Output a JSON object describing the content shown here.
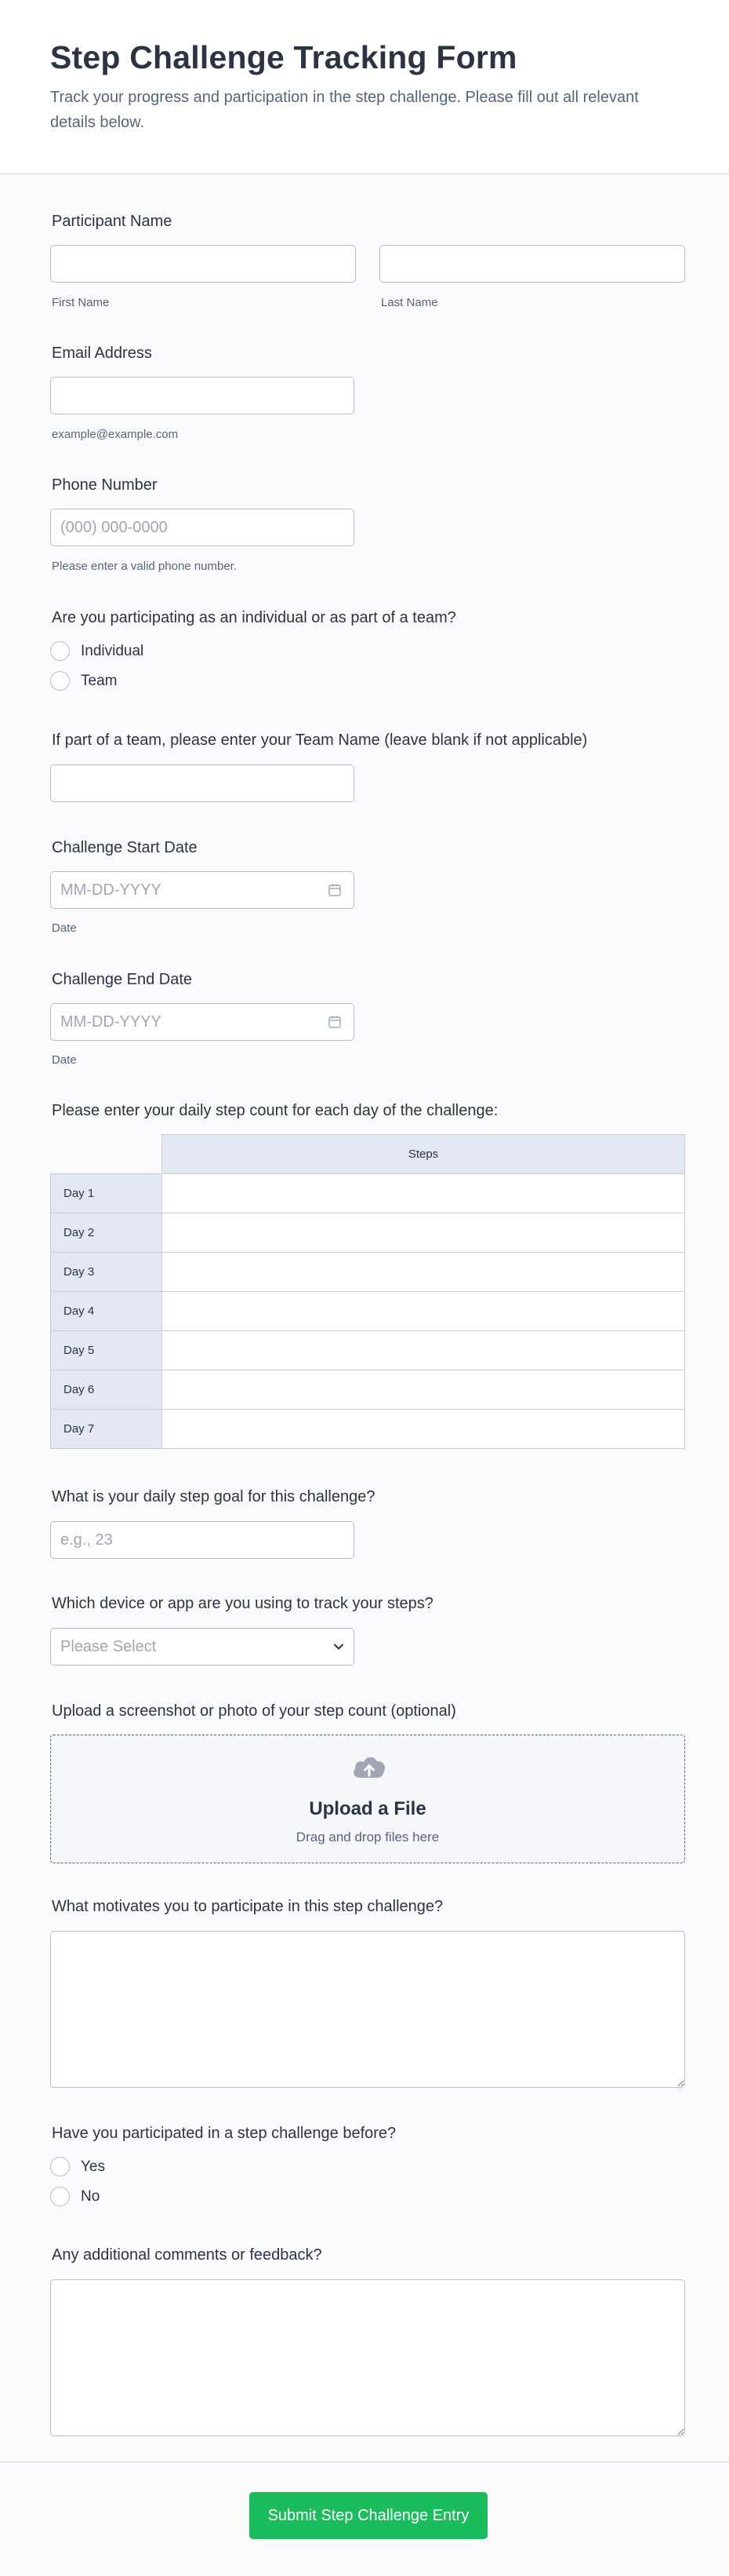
{
  "header": {
    "title": "Step Challenge Tracking Form",
    "subtitle": "Track your progress and participation in the step challenge. Please fill out all relevant details below."
  },
  "participant_name": {
    "label": "Participant Name",
    "first_sublabel": "First Name",
    "last_sublabel": "Last Name"
  },
  "email": {
    "label": "Email Address",
    "sublabel": "example@example.com"
  },
  "phone": {
    "label": "Phone Number",
    "placeholder": "(000) 000-0000",
    "sublabel": "Please enter a valid phone number."
  },
  "participation": {
    "label": "Are you participating as an individual or as part of a team?",
    "options": [
      "Individual",
      "Team"
    ]
  },
  "team_name": {
    "label": "If part of a team, please enter your Team Name (leave blank if not applicable)"
  },
  "start_date": {
    "label": "Challenge Start Date",
    "placeholder": "MM-DD-YYYY",
    "sublabel": "Date",
    "icon": "calendar-icon"
  },
  "end_date": {
    "label": "Challenge End Date",
    "placeholder": "MM-DD-YYYY",
    "sublabel": "Date",
    "icon": "calendar-icon"
  },
  "daily_steps": {
    "label": "Please enter your daily step count for each day of the challenge:",
    "column": "Steps",
    "rows": [
      "Day 1",
      "Day 2",
      "Day 3",
      "Day 4",
      "Day 5",
      "Day 6",
      "Day 7"
    ]
  },
  "step_goal": {
    "label": "What is your daily step goal for this challenge?",
    "placeholder": "e.g., 23"
  },
  "device": {
    "label": "Which device or app are you using to track your steps?",
    "selected": "Please Select",
    "icon": "chevron-down-icon"
  },
  "upload": {
    "label": "Upload a screenshot or photo of your step count (optional)",
    "title": "Upload a File",
    "subtitle": "Drag and drop files here",
    "icon": "cloud-upload-icon"
  },
  "motivation": {
    "label": "What motivates you to participate in this step challenge?"
  },
  "previous": {
    "label": "Have you participated in a step challenge before?",
    "options": [
      "Yes",
      "No"
    ]
  },
  "comments": {
    "label": "Any additional comments or feedback?"
  },
  "submit": {
    "label": "Submit Step Challenge Entry",
    "color": "#1bbc5c"
  },
  "colors": {
    "text": "#2c3345",
    "muted": "#57647e",
    "border": "#b8bdc9",
    "header_cell": "#e4e8f3"
  }
}
